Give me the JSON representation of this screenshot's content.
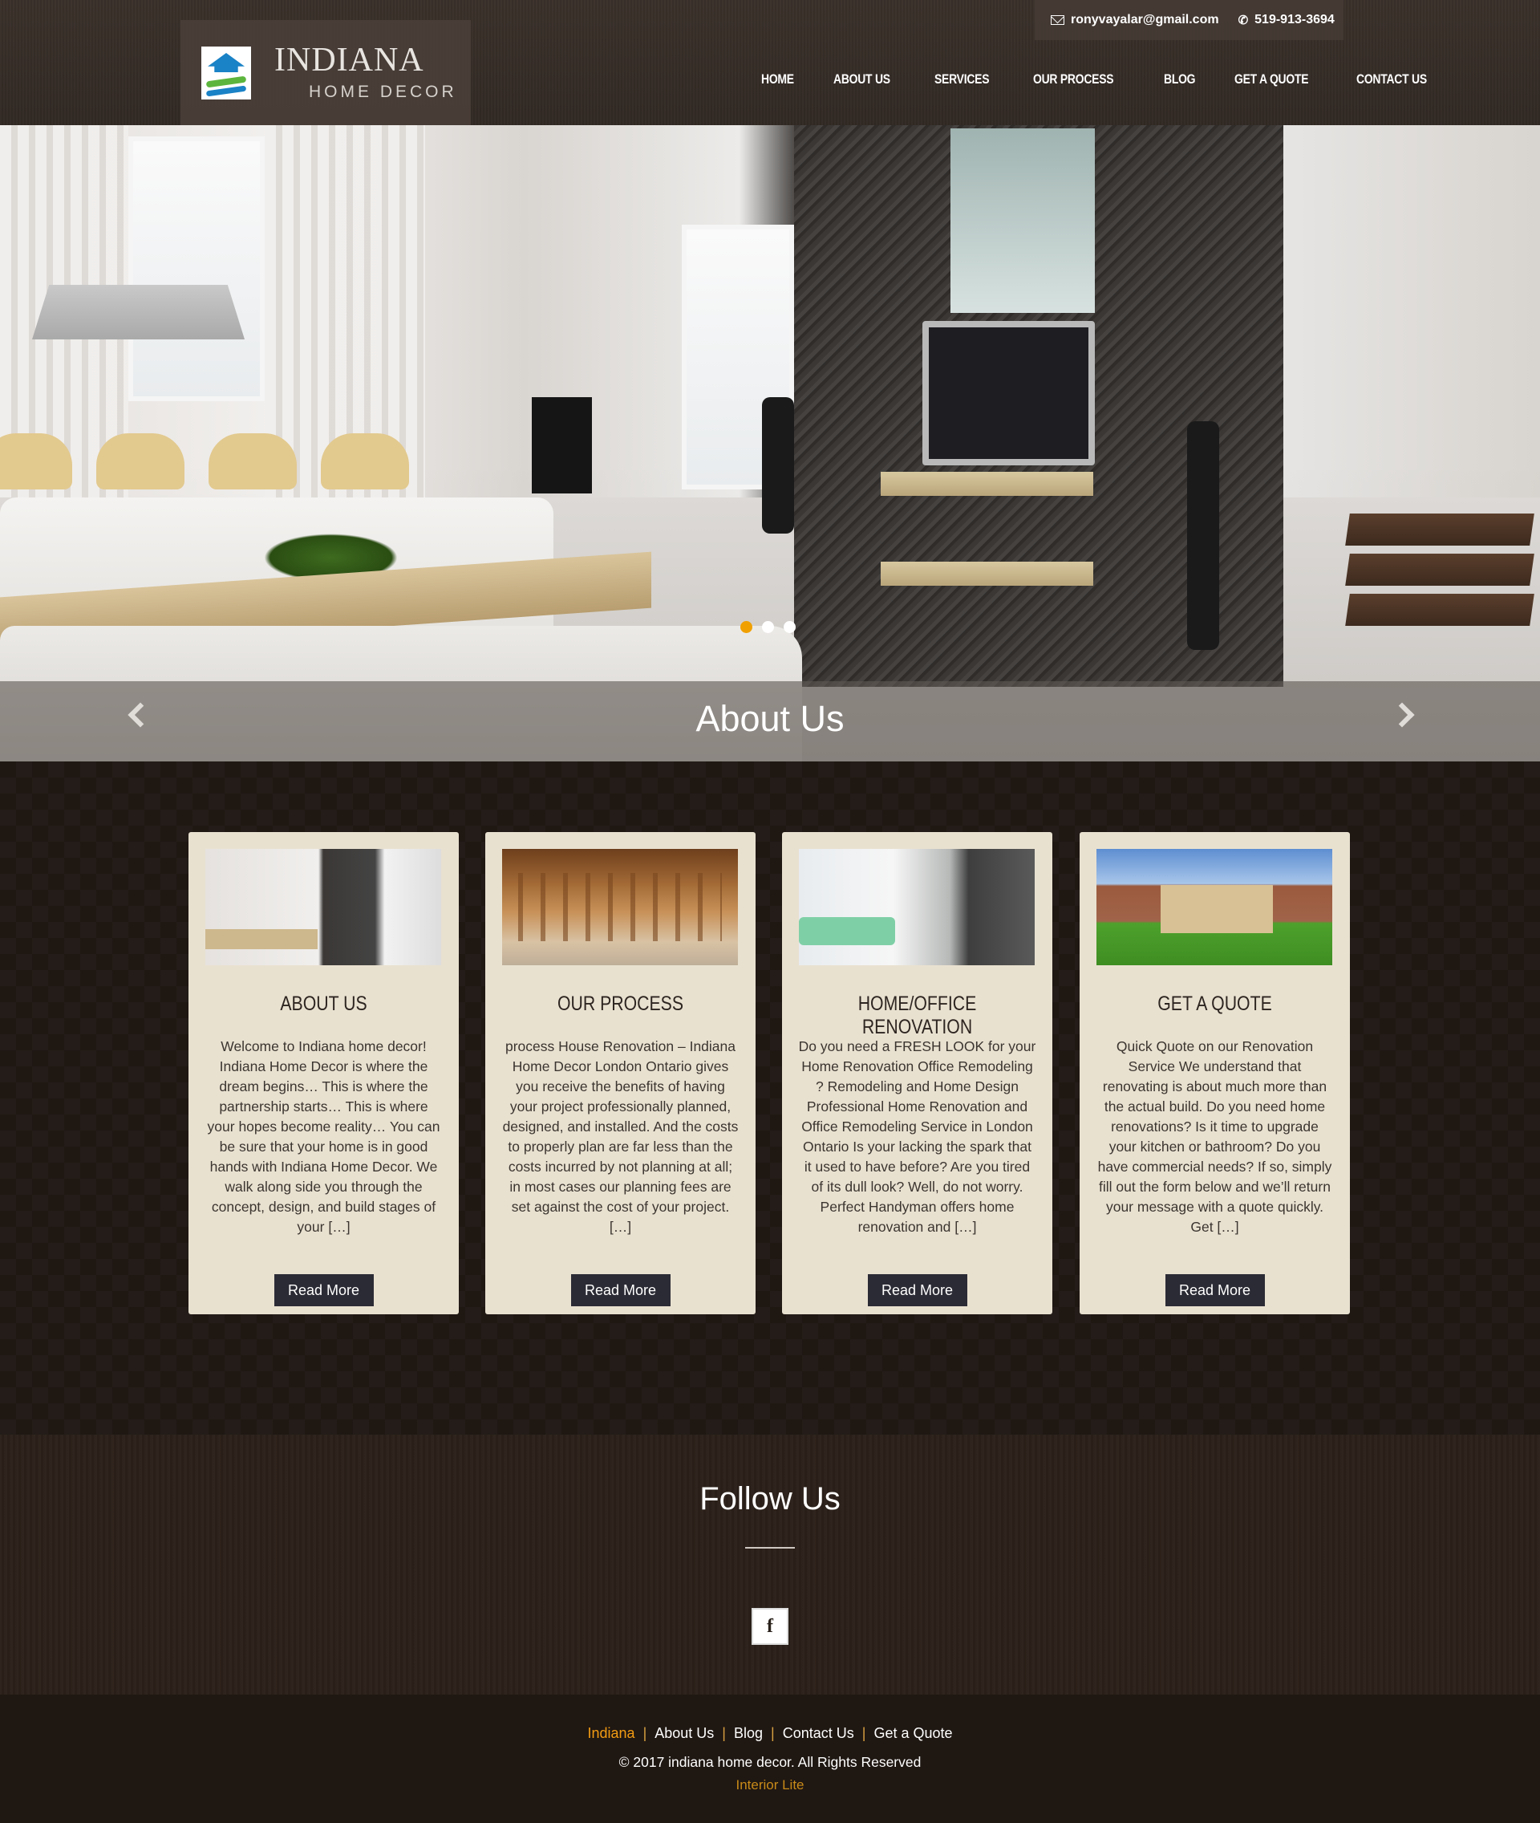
{
  "header": {
    "logo_title": "INDIANA",
    "logo_subtitle": "HOME DECOR",
    "email": "ronyvayalar@gmail.com",
    "phone": "519-913-3694",
    "nav": [
      "HOME",
      "ABOUT US",
      "SERVICES",
      "OUR PROCESS",
      "BLOG",
      "GET A QUOTE",
      "CONTACT US"
    ]
  },
  "slider": {
    "caption": "About Us",
    "slide_count": 3,
    "active_slide": 1
  },
  "cards": [
    {
      "title": "ABOUT US",
      "body": "Welcome to Indiana home decor! Indiana Home Decor is where the dream begins… This is where the partnership starts… This is where your hopes become reality… You can be sure that your home is in good hands with Indiana Home Decor. We walk along side you through the concept, design, and build stages of your […]",
      "button": "Read More"
    },
    {
      "title": "OUR PROCESS",
      "body": "process House Renovation – Indiana Home Decor London Ontario gives you receive the benefits of having your project professionally planned, designed, and installed. And the costs to properly plan are far less than the costs incurred by not planning at all; in most cases our planning fees are set against the cost of your project. […]",
      "button": "Read More"
    },
    {
      "title": "HOME/OFFICE RENOVATION",
      "body": "Do you need a FRESH LOOK for your Home Renovation Office Remodeling ? Remodeling and Home Design Professional Home Renovation and Office Remodeling Service in London Ontario Is your lacking the spark that it used to have before? Are you tired of its dull look? Well, do not worry. Perfect Handyman offers home renovation and […]",
      "button": "Read More"
    },
    {
      "title": "GET A QUOTE",
      "body": "Quick Quote on our Renovation Service We understand that renovating is about much more than the actual build. Do you need home renovations? Is it time to upgrade your kitchen or bathroom? Do you have commercial needs? If so, simply fill out the form below and we’ll return your message with a quote quickly. Get […]",
      "button": "Read More"
    }
  ],
  "follow": {
    "title": "Follow Us",
    "facebook_icon": "f"
  },
  "footer": {
    "links": [
      "Indiana",
      "About Us",
      "Blog",
      "Contact Us",
      "Get a Quote"
    ],
    "copyright": "© 2017 indiana home decor. All Rights Reserved",
    "credit": "Interior Lite"
  },
  "colors": {
    "accent": "#f39c12",
    "card_bg": "#e9e1d0",
    "button_bg": "#2b2b35",
    "dark_bg": "#1e1712"
  }
}
